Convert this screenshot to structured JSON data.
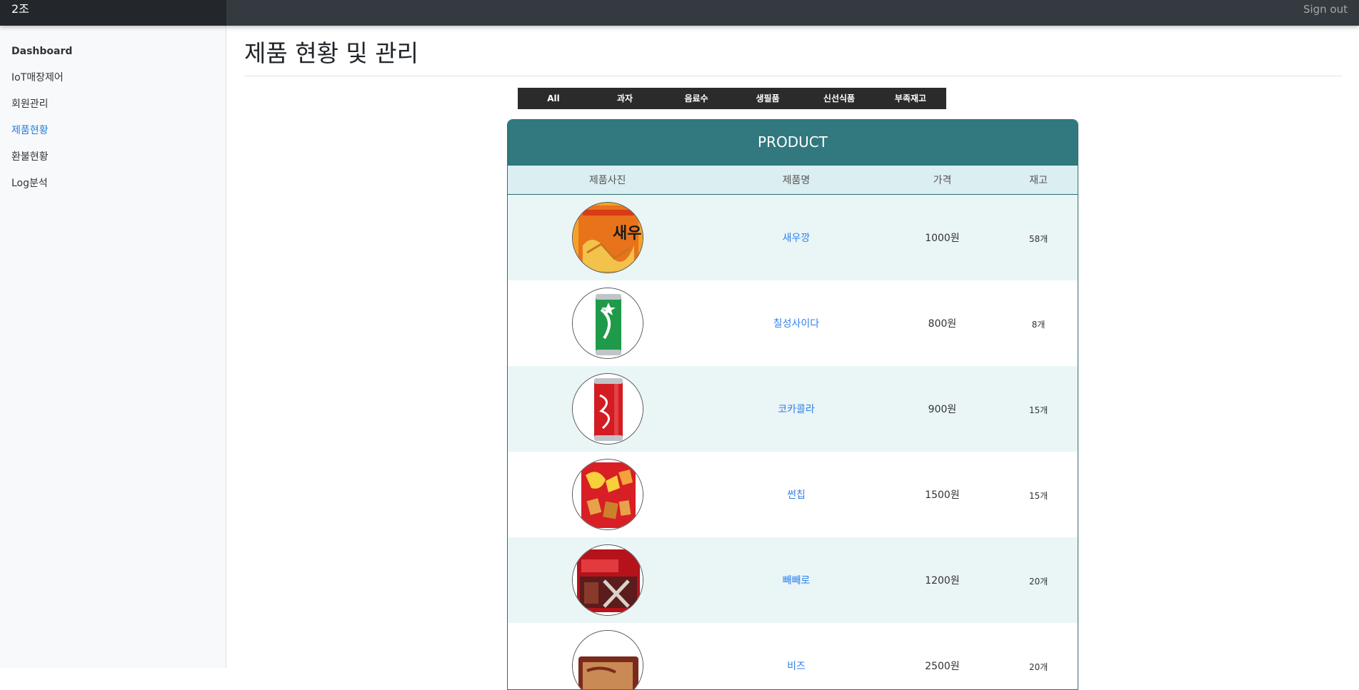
{
  "navbar": {
    "brand": "2조",
    "signout": "Sign out"
  },
  "sidebar": {
    "items": [
      {
        "label": "Dashboard",
        "active": false
      },
      {
        "label": "IoT매장제어",
        "active": false
      },
      {
        "label": "회원관리",
        "active": false
      },
      {
        "label": "제품현황",
        "active": true
      },
      {
        "label": "환불현황",
        "active": false
      },
      {
        "label": "Log분석",
        "active": false
      }
    ]
  },
  "main": {
    "title": "제품 현황 및 관리",
    "tabs": [
      "All",
      "과자",
      "음료수",
      "생필품",
      "신선식품",
      "부족재고"
    ],
    "panel": {
      "header": "PRODUCT",
      "columns": [
        "제품사진",
        "제품명",
        "가격",
        "재고"
      ],
      "rows": [
        {
          "name": "새우깡",
          "price": "1000원",
          "stock": "58개"
        },
        {
          "name": "칠성사이다",
          "price": "800원",
          "stock": "8개"
        },
        {
          "name": "코카콜라",
          "price": "900원",
          "stock": "15개"
        },
        {
          "name": "썬칩",
          "price": "1500원",
          "stock": "15개"
        },
        {
          "name": "빼빼로",
          "price": "1200원",
          "stock": "20개"
        },
        {
          "name": "비즈",
          "price": "2500원",
          "stock": "20개"
        }
      ]
    }
  },
  "colors": {
    "navbar": "#343a40",
    "brand_bg": "#23272b",
    "panel_header": "#31787f",
    "row_alt": "#eaf5f6",
    "link": "#2f80ed",
    "active_nav": "#1f7fe0"
  }
}
